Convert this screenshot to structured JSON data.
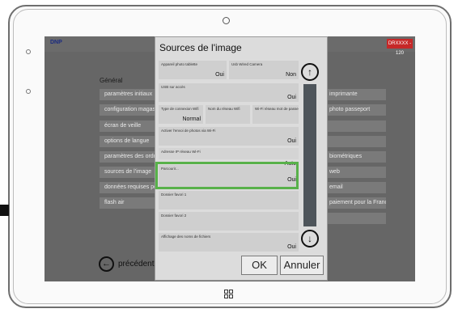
{
  "app": {
    "brand": "DNP",
    "badge": "DRXXXX - 120"
  },
  "left_menu": {
    "section_title": "Général",
    "items": [
      "paramètres initiaux",
      "configuration magasin",
      "écran de veille",
      "options de langue",
      "paramètres des ordres",
      "sources de l'image",
      "données requises pour",
      "flash air"
    ]
  },
  "right_menu": {
    "items": [
      "imprimante",
      "photo passeport",
      "",
      "",
      "biométriques",
      "web",
      "email",
      "paiement pour la France)",
      ""
    ]
  },
  "back": {
    "label": "précédent"
  },
  "dialog": {
    "title": "Sources de l'image",
    "settings": [
      {
        "label": "Appareil photo tablette",
        "value": "Oui"
      },
      {
        "label": "Usb Wired Camera",
        "value": "Non"
      },
      {
        "label": "USB sur accès",
        "value": "Oui"
      },
      {
        "label": "Type de connexion Wifi",
        "value": "Normal"
      },
      {
        "label": "Nom du réseau Wifi",
        "value": ""
      },
      {
        "label": "Wi-Fi réseau mot de passe",
        "value": ""
      },
      {
        "label": "Activer l'envoi de photos via Wi-Fi",
        "value": "Oui"
      },
      {
        "label": "Adresse IP réseau Wi-Fi",
        "value": "Auto"
      },
      {
        "label": "Parcourir...",
        "value": "Oui"
      },
      {
        "label": "Dossier favori 1",
        "value": ""
      },
      {
        "label": "Dossier favori 2",
        "value": ""
      },
      {
        "label": "Affichage des noms de fichiers",
        "value": "Oui"
      }
    ],
    "ok_label": "OK",
    "cancel_label": "Annuler",
    "scroll_up_icon": "arrow-up-circle-icon",
    "scroll_down_icon": "arrow-down-circle-icon"
  },
  "highlight_color": "#58b14a"
}
